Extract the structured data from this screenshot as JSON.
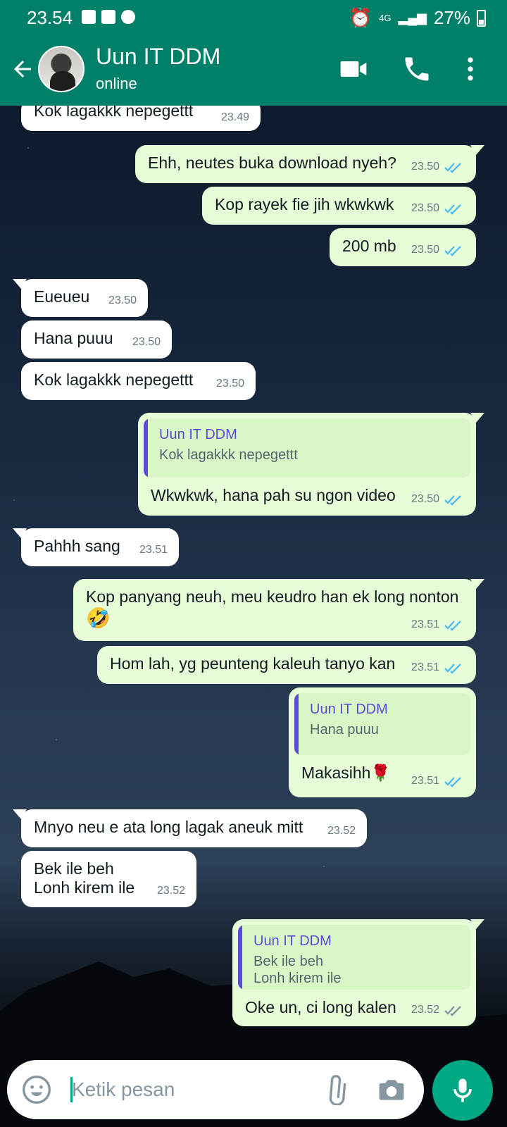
{
  "status_bar": {
    "time": "23.54",
    "network": "4G",
    "battery": "27%"
  },
  "header": {
    "contact_name": "Uun IT DDM",
    "status": "online"
  },
  "messages": [
    {
      "dir": "in",
      "text": "Kok lagakkk nepegettt",
      "time": "23.49"
    },
    {
      "dir": "out",
      "text": "Ehh, neutes buka download nyeh?",
      "time": "23.50"
    },
    {
      "dir": "out",
      "text": "Kop rayek fie jih wkwkwk",
      "time": "23.50"
    },
    {
      "dir": "out",
      "text": "200 mb",
      "time": "23.50"
    },
    {
      "dir": "in",
      "text": "Eueueu",
      "time": "23.50"
    },
    {
      "dir": "in",
      "text": "Hana puuu",
      "time": "23.50"
    },
    {
      "dir": "in",
      "text": "Kok lagakkk nepegettt",
      "time": "23.50"
    },
    {
      "dir": "out",
      "quote_author": "Uun IT DDM",
      "quote_text": "Kok lagakkk nepegettt",
      "text": "Wkwkwk, hana pah su ngon video",
      "time": "23.50"
    },
    {
      "dir": "in",
      "text": "Pahhh sang",
      "time": "23.51"
    },
    {
      "dir": "out",
      "text": "Kop panyang neuh, meu keudro han ek long nonton",
      "emoji": "🤣",
      "time": "23.51"
    },
    {
      "dir": "out",
      "text": "Hom lah, yg peunteng kaleuh tanyo kan",
      "time": "23.51"
    },
    {
      "dir": "out",
      "quote_author": "Uun IT DDM",
      "quote_text": "Hana puuu",
      "text": "Makasihh🌹",
      "time": "23.51"
    },
    {
      "dir": "in",
      "text": "Mnyo neu e ata long lagak aneuk mitt",
      "time": "23.52"
    },
    {
      "dir": "in",
      "text": "Bek ile beh\nLonh kirem ile",
      "time": "23.52"
    },
    {
      "dir": "out",
      "quote_author": "Uun IT DDM",
      "quote_text": "Bek ile beh\nLonh kirem ile",
      "text": "Oke un, ci long kalen",
      "time": "23.52",
      "read": false
    }
  ],
  "input": {
    "placeholder": "Ketik pesan"
  },
  "colors": {
    "header": "#008069",
    "outgoing_bubble": "#e7fdd7",
    "incoming_bubble": "#ffffff",
    "read_ticks": "#53bdeb",
    "accent": "#00a884"
  }
}
